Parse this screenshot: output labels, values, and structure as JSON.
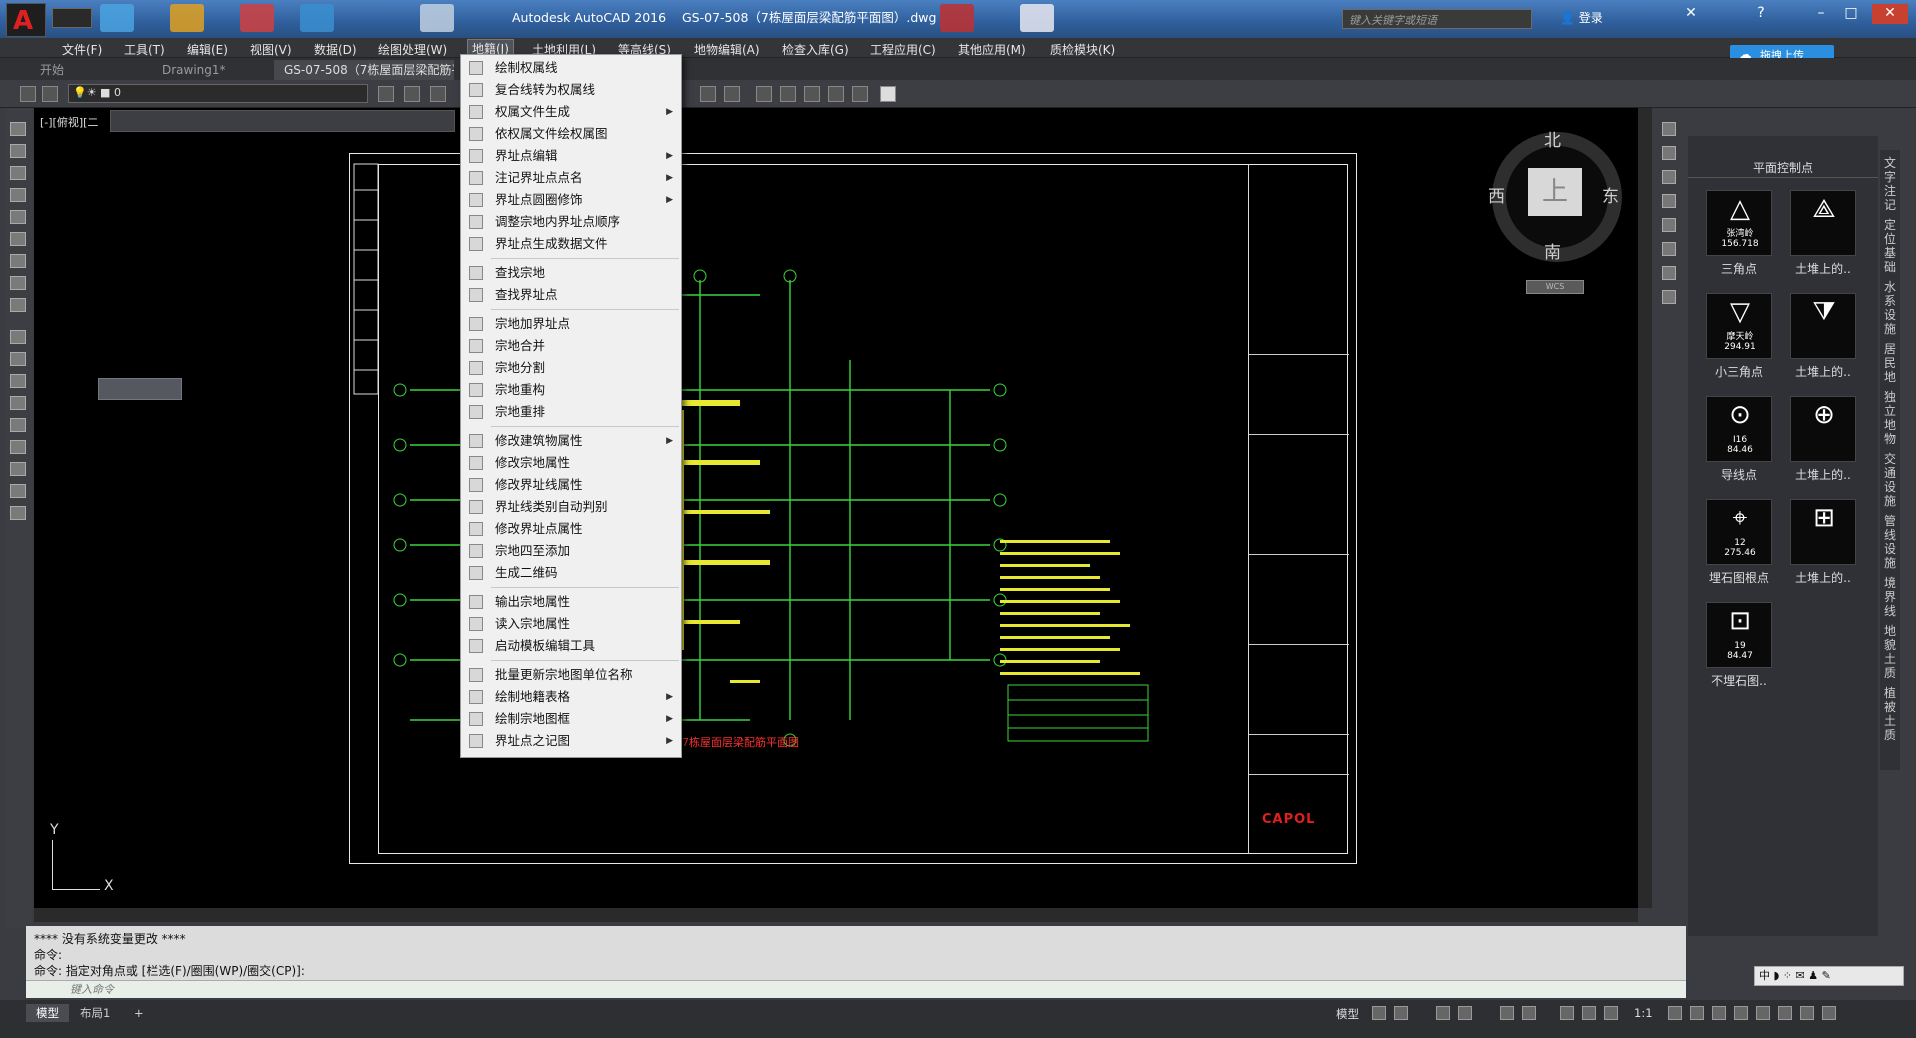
{
  "app": {
    "title": "Autodesk AutoCAD 2016",
    "document": "GS-07-508（7栋屋面层梁配筋平面图）.dwg"
  },
  "search": {
    "placeholder": "键入关键字或短语"
  },
  "user": {
    "login": "登录"
  },
  "menubar": [
    "文件(F)",
    "工具(T)",
    "编辑(E)",
    "视图(V)",
    "数据(D)",
    "绘图处理(W)",
    "地籍(J)",
    "土地利用(L)",
    "等高线(S)",
    "地物编辑(A)",
    "检查入库(G)",
    "工程应用(C)",
    "其他应用(M)",
    "质检模块(K)"
  ],
  "cloud_button": "拖拽上传",
  "tabs": [
    "开始",
    "Drawing1*",
    "GS-07-508（7栋屋面层梁配筋平"
  ],
  "layer": {
    "value": "0"
  },
  "viewport_label": "[-][俯视][二",
  "dropdown": [
    {
      "label": "绘制权属线",
      "arrow": false
    },
    {
      "label": "复合线转为权属线",
      "arrow": false
    },
    {
      "label": "权属文件生成",
      "arrow": true
    },
    {
      "label": "依权属文件绘权属图",
      "arrow": false
    },
    {
      "label": "界址点编辑",
      "arrow": true
    },
    {
      "label": "注记界址点点名",
      "arrow": true
    },
    {
      "label": "界址点圆圈修饰",
      "arrow": true
    },
    {
      "label": "调整宗地内界址点顺序",
      "arrow": false
    },
    {
      "label": "界址点生成数据文件",
      "arrow": false
    },
    {
      "label": "查找宗地",
      "arrow": false
    },
    {
      "label": "查找界址点",
      "arrow": false
    },
    {
      "label": "宗地加界址点",
      "arrow": false
    },
    {
      "label": "宗地合并",
      "arrow": false
    },
    {
      "label": "宗地分割",
      "arrow": false
    },
    {
      "label": "宗地重构",
      "arrow": false
    },
    {
      "label": "宗地重排",
      "arrow": false
    },
    {
      "label": "修改建筑物属性",
      "arrow": true
    },
    {
      "label": "修改宗地属性",
      "arrow": false
    },
    {
      "label": "修改界址线属性",
      "arrow": false
    },
    {
      "label": "界址线类别自动判别",
      "arrow": false
    },
    {
      "label": "修改界址点属性",
      "arrow": false
    },
    {
      "label": "宗地四至添加",
      "arrow": false
    },
    {
      "label": "生成二维码",
      "arrow": false
    },
    {
      "label": "输出宗地属性",
      "arrow": false
    },
    {
      "label": "读入宗地属性",
      "arrow": false
    },
    {
      "label": "启动模板编辑工具",
      "arrow": false
    },
    {
      "label": "批量更新宗地图单位名称",
      "arrow": false
    },
    {
      "label": "绘制地籍表格",
      "arrow": true
    },
    {
      "label": "绘制宗地图框",
      "arrow": true
    },
    {
      "label": "界址点之记图",
      "arrow": true
    }
  ],
  "compass": {
    "north": "北",
    "south": "南",
    "east": "东",
    "west": "西",
    "top": "上",
    "wcs": "WCS"
  },
  "palette": {
    "title": "平面控制点",
    "items": [
      {
        "label": "三角点",
        "sym": "△",
        "sub1": "张湾岭",
        "sub2": "156.718"
      },
      {
        "label": "土堆上的..",
        "sym": "⟁",
        "sub1": "",
        "sub2": ""
      },
      {
        "label": "小三角点",
        "sym": "▽",
        "sub1": "摩天岭",
        "sub2": "294.91"
      },
      {
        "label": "土堆上的..",
        "sym": "⧩",
        "sub1": "",
        "sub2": ""
      },
      {
        "label": "导线点",
        "sym": "⊙",
        "sub1": "I16",
        "sub2": "84.46"
      },
      {
        "label": "土堆上的..",
        "sym": "⊕",
        "sub1": "",
        "sub2": ""
      },
      {
        "label": "埋石图根点",
        "sym": "⌖",
        "sub1": "12",
        "sub2": "275.46"
      },
      {
        "label": "土堆上的..",
        "sym": "⊞",
        "sub1": "",
        "sub2": ""
      },
      {
        "label": "不埋石图..",
        "sym": "⊡",
        "sub1": "19",
        "sub2": "84.47"
      }
    ]
  },
  "right_strip": [
    "文字注记",
    "定位基础",
    "水系设施",
    "居民地",
    "独立地物",
    "交通设施",
    "管线设施",
    "境界线",
    "地貌土质",
    "植被土质"
  ],
  "drawing": {
    "brand": "CAPOL",
    "red_title": "7栋屋面层梁配筋平面图"
  },
  "command": {
    "lines": [
      "**** 没有系统变量更改 ****",
      "命令:",
      "命令: 指定对角点或 [栏选(F)/圈围(WP)/圈交(CP)]:"
    ],
    "input_placeholder": "键入命令"
  },
  "status": {
    "model": "模型",
    "layout": "布局1",
    "add": "+",
    "scale": "1:1",
    "model_label": "模型"
  },
  "ime": "中 ◗ ⁘ ✉ ♟ ✎",
  "axis": {
    "y": "Y",
    "x": "X"
  }
}
